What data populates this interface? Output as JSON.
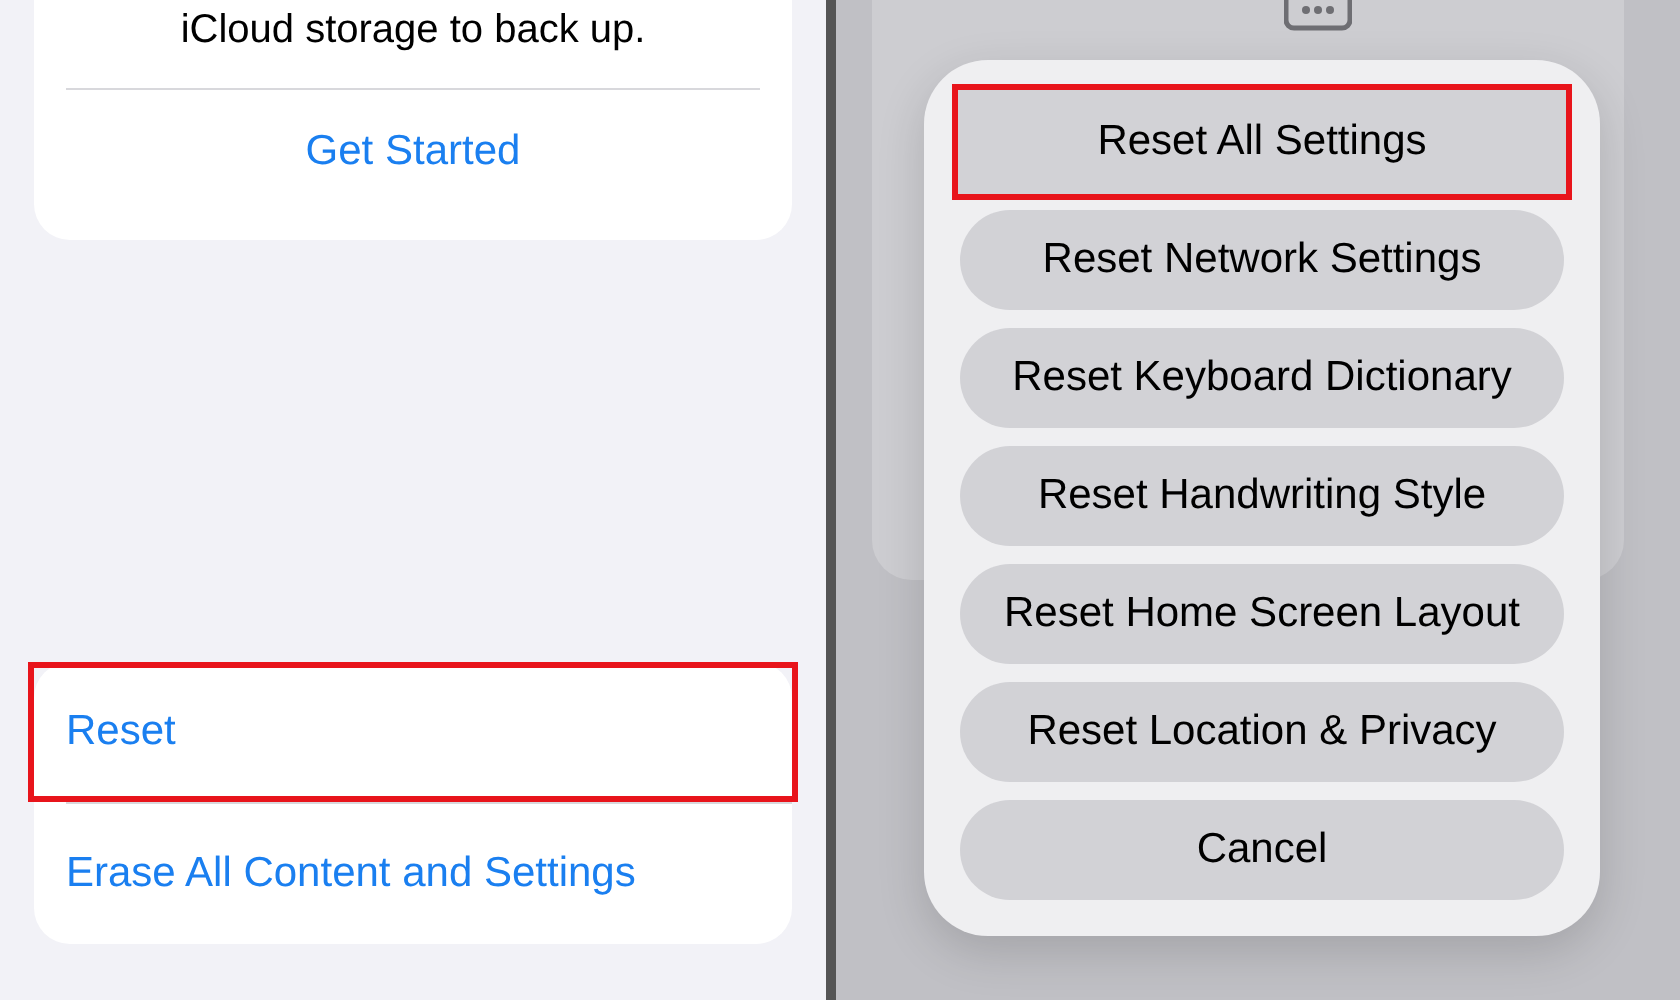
{
  "left_screen": {
    "info_card": {
      "text": "iCloud storage to back up.",
      "link": "Get Started"
    },
    "reset_list": [
      {
        "label": "Reset",
        "highlighted": true
      },
      {
        "label": "Erase All Content and Settings",
        "highlighted": false
      }
    ]
  },
  "right_screen": {
    "action_sheet": [
      {
        "label": "Reset All Settings",
        "highlighted": true
      },
      {
        "label": "Reset Network Settings",
        "highlighted": false
      },
      {
        "label": "Reset Keyboard Dictionary",
        "highlighted": false
      },
      {
        "label": "Reset Handwriting Style",
        "highlighted": false
      },
      {
        "label": "Reset Home Screen Layout",
        "highlighted": false
      },
      {
        "label": "Reset Location & Privacy",
        "highlighted": false
      },
      {
        "label": "Cancel",
        "highlighted": false
      }
    ]
  }
}
